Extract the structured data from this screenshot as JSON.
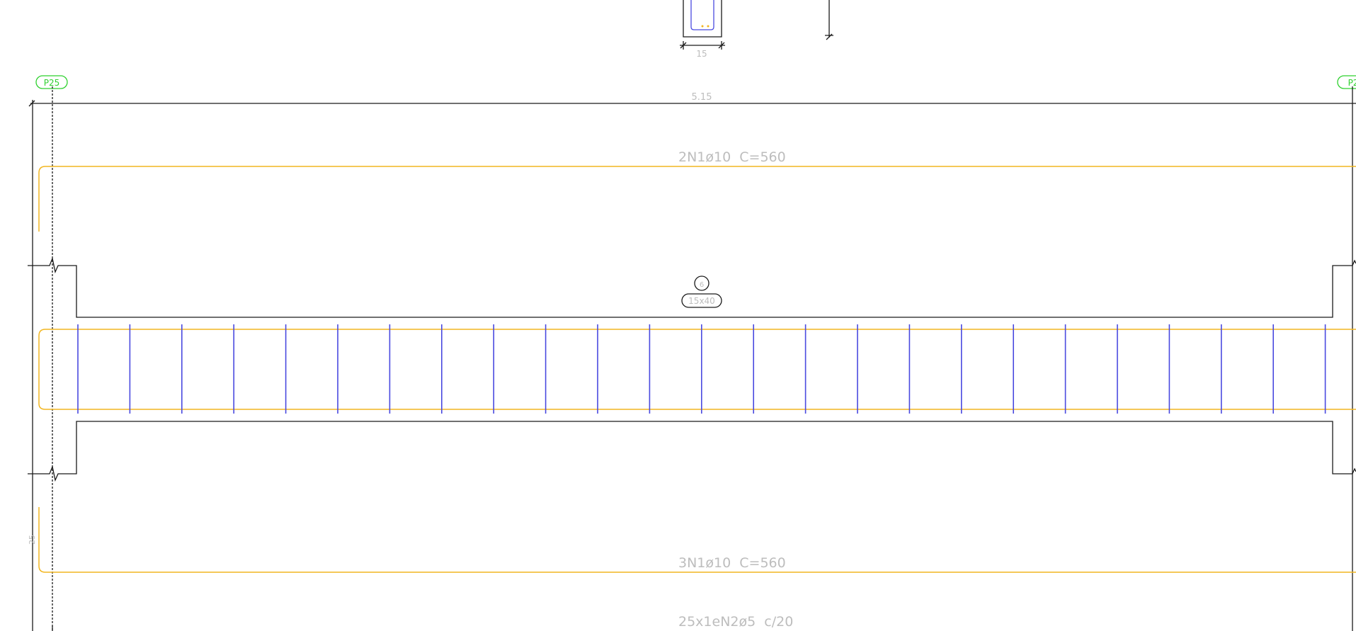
{
  "drawing": {
    "pillar_left_tag": "P25",
    "pillar_right_tag": "P2",
    "span_dimension": "5.15",
    "section_width_dimension": "15",
    "top_bar_label": "2N1ø10  C=560",
    "bottom_bar_label": "3N1ø10  C=560",
    "stirrup_label": "25x1eN2ø5  c/20",
    "beam_number": "6",
    "beam_section": "15x40",
    "side_dimension": "25",
    "stirrup_count": 25
  },
  "colors": {
    "outline": "#1a1a1a",
    "rebar": "#f2b620",
    "stirrup": "#4a4ae0",
    "pillar_tag": "#2fd12f",
    "label_text": "#bdbdbd"
  }
}
